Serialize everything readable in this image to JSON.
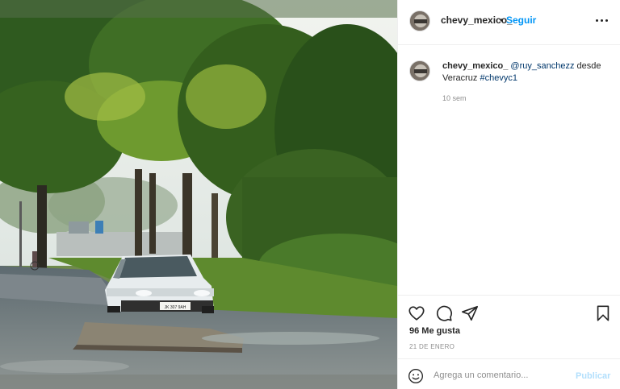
{
  "post": {
    "username": "chevy_mexico_",
    "dot": "•",
    "follow_label": "Seguir",
    "more_icon": "more-horizontal-icon",
    "caption": {
      "username": "chevy_mexico_",
      "mention": "@ruy_sanchezz",
      "text": "desde Veracruz",
      "hashtag": "#chevyc1"
    },
    "time_ago": "10 sem",
    "likes": "96 Me gusta",
    "date": "21 DE ENERO"
  },
  "actions": {
    "like_icon": "heart-icon",
    "comment_icon": "comment-icon",
    "share_icon": "share-icon",
    "save_icon": "bookmark-icon"
  },
  "comment_bar": {
    "emoji_icon": "emoji-icon",
    "placeholder": "Agrega un comentario...",
    "publish_label": "Publicar"
  },
  "photo": {
    "car_plate": "JK 307 9AH"
  }
}
